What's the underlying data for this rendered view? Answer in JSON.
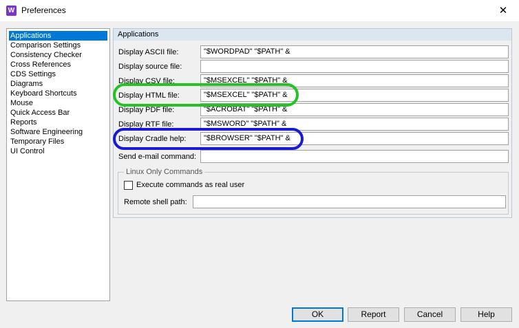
{
  "window": {
    "app_icon_letter": "W",
    "title": "Preferences",
    "close_glyph": "✕"
  },
  "sidebar": {
    "items": [
      {
        "label": "Applications",
        "selected": true
      },
      {
        "label": "Comparison Settings",
        "selected": false
      },
      {
        "label": "Consistency Checker",
        "selected": false
      },
      {
        "label": "Cross References",
        "selected": false
      },
      {
        "label": "CDS Settings",
        "selected": false
      },
      {
        "label": "Diagrams",
        "selected": false
      },
      {
        "label": "Keyboard Shortcuts",
        "selected": false
      },
      {
        "label": "Mouse",
        "selected": false
      },
      {
        "label": "Quick Access Bar",
        "selected": false
      },
      {
        "label": "Reports",
        "selected": false
      },
      {
        "label": "Software Engineering",
        "selected": false
      },
      {
        "label": "Temporary Files",
        "selected": false
      },
      {
        "label": "UI Control",
        "selected": false
      }
    ]
  },
  "panel": {
    "header": "Applications",
    "rows": [
      {
        "label": "Display ASCII file:",
        "value": "\"$WORDPAD\" \"$PATH\" &"
      },
      {
        "label": "Display source file:",
        "value": ""
      },
      {
        "label": "Display CSV file:",
        "value": "\"$MSEXCEL\" \"$PATH\" &"
      },
      {
        "label": "Display HTML file:",
        "value": "\"$MSEXCEL\" \"$PATH\" &"
      },
      {
        "label": "Display PDF file:",
        "value": "\"$ACROBAT\" \"$PATH\" &"
      },
      {
        "label": "Display RTF file:",
        "value": "\"$MSWORD\" \"$PATH\" &"
      },
      {
        "label": "Display Cradle help:",
        "value": "\"$BROWSER\" \"$PATH\" &"
      },
      {
        "label": "Send e-mail command:",
        "value": ""
      }
    ],
    "linux_group": {
      "title": "Linux Only Commands",
      "checkbox_label": "Execute commands as real user",
      "checkbox_checked": false,
      "shell_label": "Remote shell path:",
      "shell_value": ""
    }
  },
  "annotations": {
    "html_row_highlight_color": "#22c322",
    "cradle_row_highlight_color": "#1a1ad6"
  },
  "buttons": {
    "ok": "OK",
    "report": "Report",
    "cancel": "Cancel",
    "help": "Help"
  },
  "colors": {
    "selection": "#0078d7",
    "panel_header": "#dbe6f1",
    "app_icon": "#7b35c8"
  }
}
